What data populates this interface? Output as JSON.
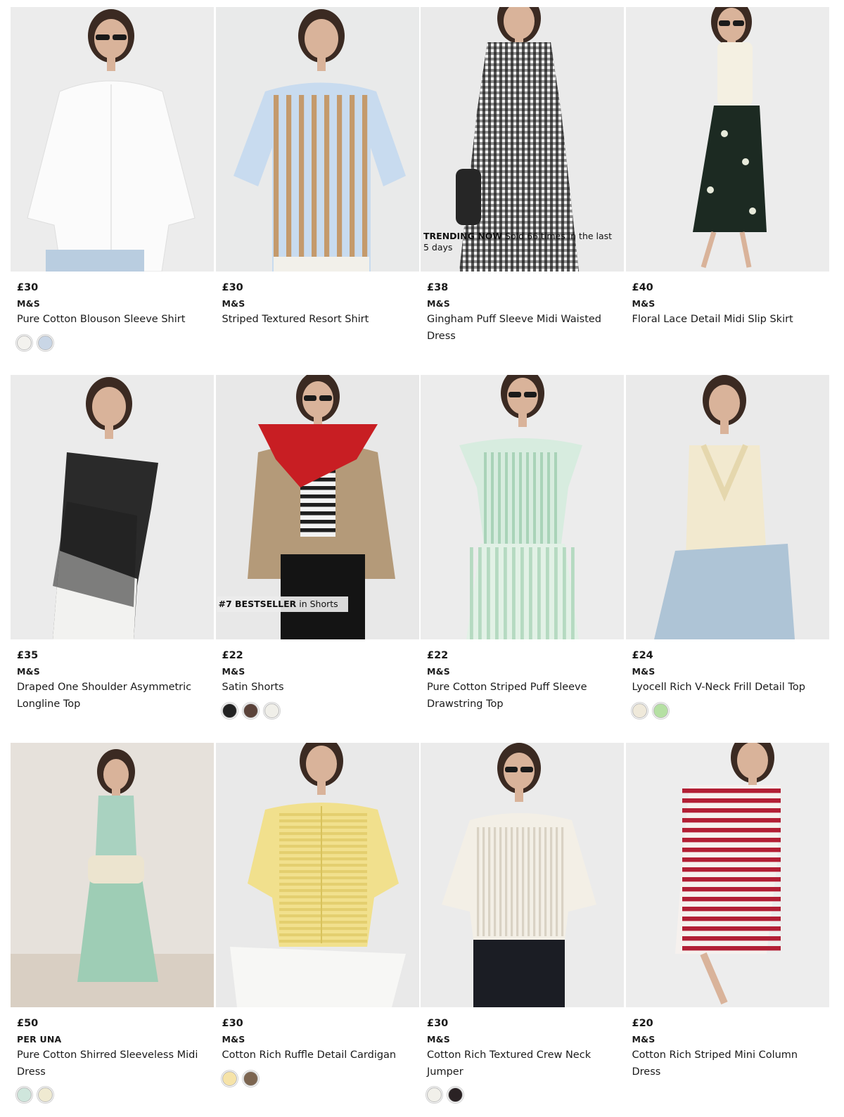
{
  "products": [
    {
      "price": "£30",
      "brand": "M&S",
      "name": "Pure Cotton Blouson Sleeve Shirt",
      "swatches": [
        "#f3f2ee",
        "#c9d6e6"
      ],
      "badge": null,
      "bg": "#ececec",
      "fig": "white-shirt"
    },
    {
      "price": "£30",
      "brand": "M&S",
      "name": "Striped Textured Resort Shirt",
      "swatches": [],
      "badge": null,
      "bg": "#e9eaea",
      "fig": "stripe-shirt"
    },
    {
      "price": "£38",
      "brand": "M&S",
      "name": "Gingham Puff Sleeve Midi Waisted Dress",
      "swatches": [],
      "badge": {
        "type": "trending",
        "bold": "TRENDING NOW",
        "text": " Sold 66 times in the last 5 days"
      },
      "bg": "#eaeaea",
      "fig": "gingham-dress"
    },
    {
      "price": "£40",
      "brand": "M&S",
      "name": "Floral Lace Detail Midi Slip Skirt",
      "swatches": [],
      "badge": null,
      "bg": "#ececec",
      "fig": "floral-skirt"
    },
    {
      "price": "£35",
      "brand": "M&S",
      "name": "Draped One Shoulder Asymmetric Longline Top",
      "swatches": [],
      "badge": null,
      "bg": "#ebebeb",
      "fig": "black-top"
    },
    {
      "price": "£22",
      "brand": "M&S",
      "name": "Satin Shorts",
      "swatches": [
        "#222222",
        "#5b433a",
        "#f0efe9"
      ],
      "badge": {
        "type": "best",
        "bold": "#7 BESTSELLER",
        "text": " in Shorts"
      },
      "bg": "#e8e8e8",
      "fig": "satin-shorts"
    },
    {
      "price": "£22",
      "brand": "M&S",
      "name": "Pure Cotton Striped Puff Sleeve Drawstring Top",
      "swatches": [],
      "badge": null,
      "bg": "#ececec",
      "fig": "mint-set"
    },
    {
      "price": "£24",
      "brand": "M&S",
      "name": "Lyocell Rich V-Neck Frill Detail Top",
      "swatches": [
        "#efe9da",
        "#b5e0a3"
      ],
      "badge": null,
      "bg": "#eaeaea",
      "fig": "cream-top"
    },
    {
      "price": "£50",
      "brand": "PER UNA",
      "name": "Pure Cotton Shirred Sleeveless Midi Dress",
      "swatches": [
        "#cfe6dc",
        "#efead1"
      ],
      "badge": null,
      "bg": "#e6e1db",
      "fig": "mint-dress"
    },
    {
      "price": "£30",
      "brand": "M&S",
      "name": "Cotton Rich Ruffle Detail Cardigan",
      "swatches": [
        "#f6e3a8",
        "#7c6550"
      ],
      "badge": null,
      "bg": "#e9e9e9",
      "fig": "yellow-cardigan"
    },
    {
      "price": "£30",
      "brand": "M&S",
      "name": "Cotton Rich Textured Crew Neck Jumper",
      "swatches": [
        "#f1f0ea",
        "#2a2224"
      ],
      "badge": null,
      "bg": "#ebebeb",
      "fig": "knit-jumper"
    },
    {
      "price": "£20",
      "brand": "M&S",
      "name": "Cotton Rich Striped Mini Column Dress",
      "swatches": [],
      "badge": null,
      "bg": "#ededed",
      "fig": "red-stripe-dress"
    }
  ]
}
